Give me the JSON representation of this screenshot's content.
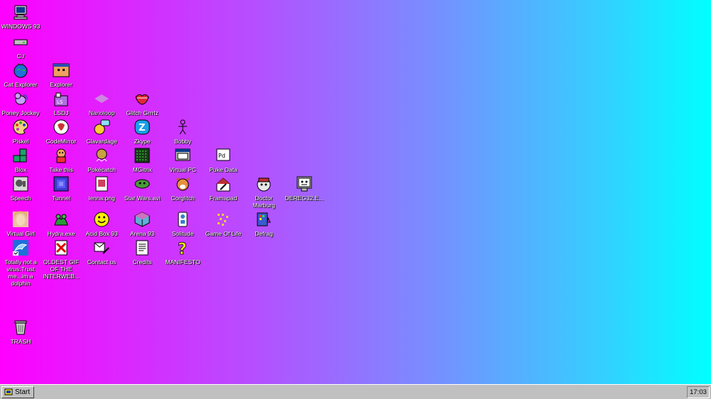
{
  "desktop": {
    "icons": [
      {
        "label": "WINDOWS 93",
        "icon": "computer-icon"
      },
      {
        "label": "C:/",
        "icon": "drive-icon"
      },
      {
        "label": "Cat Explorer",
        "icon": "cat-globe-icon"
      },
      {
        "label": "Explorer",
        "icon": "explorer-icon"
      },
      {
        "label": "Poney Jockey",
        "icon": "pony-icon"
      },
      {
        "label": "LSDJ",
        "icon": "lsdj-icon"
      },
      {
        "label": "Nanoloop",
        "icon": "nanoloop-icon"
      },
      {
        "label": "Glitch Grrrlz",
        "icon": "lips-icon"
      },
      {
        "label": "Piskel",
        "icon": "palette-icon"
      },
      {
        "label": "CodeMirror",
        "icon": "codemirror-icon"
      },
      {
        "label": "Clavardage",
        "icon": "chat-icon"
      },
      {
        "label": "Zkype",
        "icon": "zkype-icon"
      },
      {
        "label": "Bobby",
        "icon": "stick-figure-icon"
      },
      {
        "label": "Blox",
        "icon": "blocks-icon"
      },
      {
        "label": "Take this",
        "icon": "take-this-icon"
      },
      {
        "label": "Pokécatch",
        "icon": "pokecatch-icon"
      },
      {
        "label": "MGitrix",
        "icon": "mgitrix-icon"
      },
      {
        "label": "Virtual PC",
        "icon": "virtual-pc-icon"
      },
      {
        "label": "Puke Data",
        "icon": "puke-data-icon"
      },
      {
        "label": "Speech",
        "icon": "speech-icon"
      },
      {
        "label": "Tunnel",
        "icon": "tunnel-icon"
      },
      {
        "label": "lenna.png",
        "icon": "image-file-icon"
      },
      {
        "label": "Star Wars.avi",
        "icon": "yoda-icon"
      },
      {
        "label": "Corglitch",
        "icon": "corgi-icon"
      },
      {
        "label": "Framapad",
        "icon": "framapad-icon"
      },
      {
        "label": "Doctor Marburg",
        "icon": "doctor-icon"
      },
      {
        "label": "DEREG32.E...",
        "icon": "dereg-icon"
      },
      {
        "label": "Virtual Girl",
        "icon": "virtual-girl-icon"
      },
      {
        "label": "Hydra.exe",
        "icon": "hydra-icon"
      },
      {
        "label": "Acid Box 93",
        "icon": "smiley-icon"
      },
      {
        "label": "Arena 93",
        "icon": "cube-icon"
      },
      {
        "label": "Solitude",
        "icon": "solitude-icon"
      },
      {
        "label": "Game Of Life",
        "icon": "game-of-life-icon"
      },
      {
        "label": "Defrag",
        "icon": "defrag-icon"
      },
      {
        "label": "Totally not a virus.Trust me...im a dolphin",
        "icon": "dolphin-icon"
      },
      {
        "label": "OLDEST GIF OF THE INTERWEB...",
        "icon": "gif-icon"
      },
      {
        "label": "Contact us",
        "icon": "contact-icon"
      },
      {
        "label": "Credits",
        "icon": "document-icon"
      },
      {
        "label": "MANIFESTO",
        "icon": "question-icon"
      },
      {
        "label": "TRASH",
        "icon": "trash-icon"
      }
    ]
  },
  "taskbar": {
    "start_label": "Start",
    "clock": "17:03"
  }
}
